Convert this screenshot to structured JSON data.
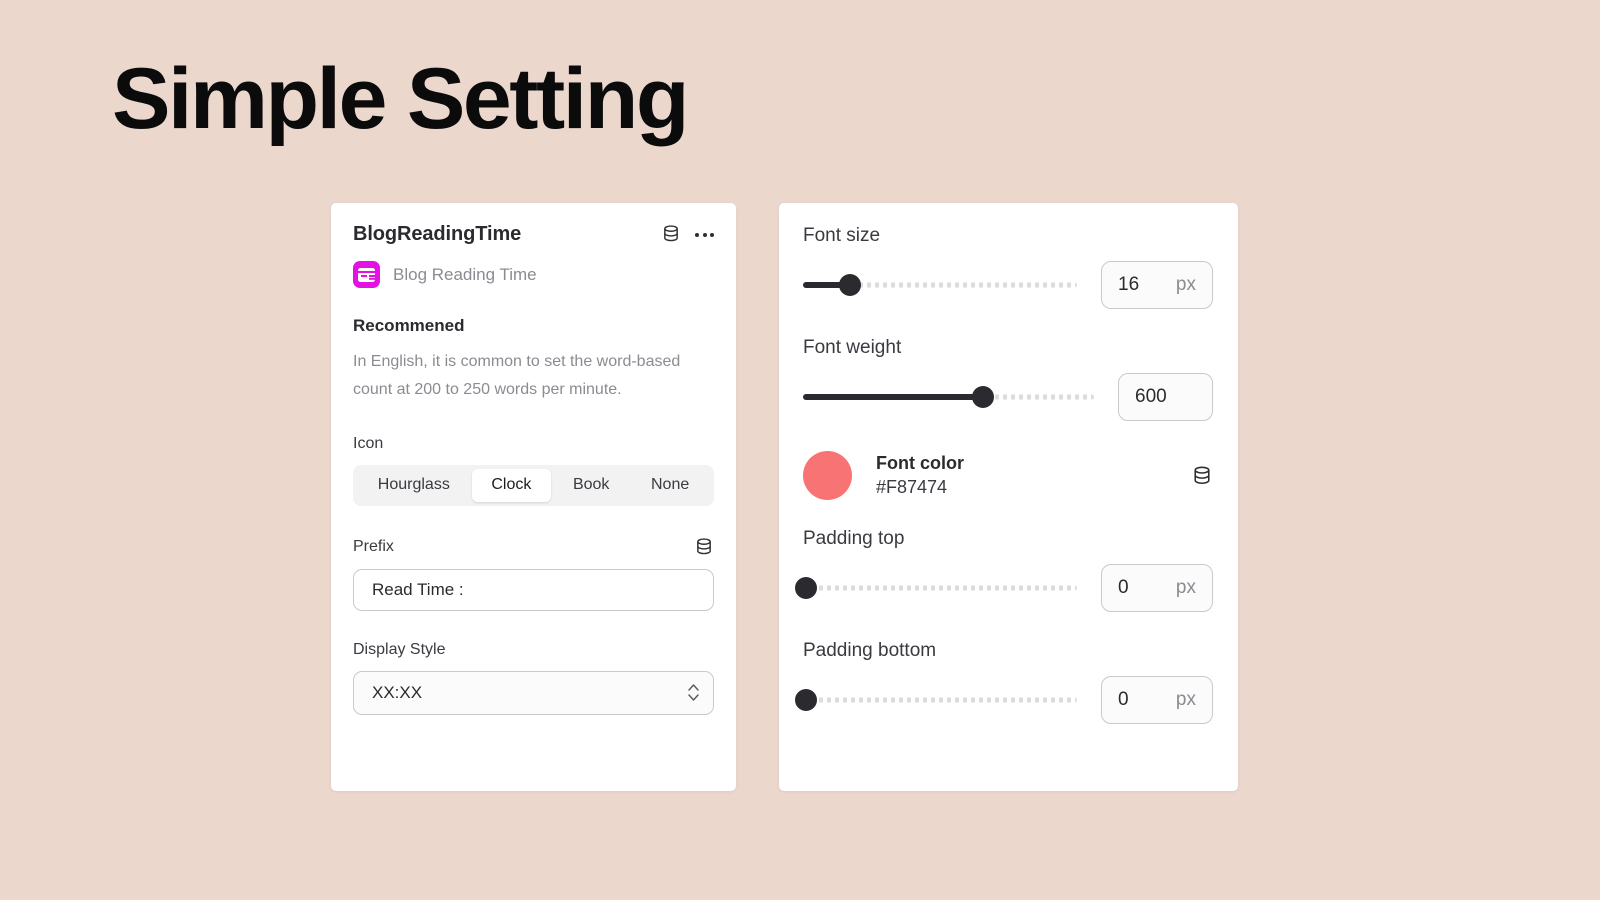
{
  "page": {
    "title": "Simple Setting",
    "background_color": "#EBD7CC"
  },
  "left_panel": {
    "title": "BlogReadingTime",
    "database_icon": "database-icon",
    "more_icon": "more-options-icon",
    "app_icon": "blog-reading-time-app-icon",
    "app_icon_color": "#E312E3",
    "app_name": "Blog Reading Time",
    "recommend": {
      "heading": "Recommened",
      "body": "In English, it is common to set the word-based count at 200 to 250 words per minute."
    },
    "icon_field": {
      "label": "Icon",
      "options": [
        "Hourglass",
        "Clock",
        "Book",
        "None"
      ],
      "selected": "Clock"
    },
    "prefix_field": {
      "label": "Prefix",
      "database_icon": "database-icon",
      "value": "Read Time :",
      "placeholder": "Read Time :"
    },
    "display_style_field": {
      "label": "Display Style",
      "value": "XX:XX",
      "options": [
        "XX:XX"
      ]
    }
  },
  "right_panel": {
    "font_size": {
      "label": "Font size",
      "value": "16",
      "unit": "px",
      "percent": 17,
      "min": 0,
      "max": 100
    },
    "font_weight": {
      "label": "Font weight",
      "value": "600",
      "unit": "",
      "percent": 62,
      "min": 100,
      "max": 900
    },
    "font_color": {
      "label": "Font color",
      "value": "#F87474",
      "swatch_color": "#F87474",
      "database_icon": "database-icon"
    },
    "padding_top": {
      "label": "Padding top",
      "value": "0",
      "unit": "px",
      "percent": 0,
      "min": 0,
      "max": 100
    },
    "padding_bottom": {
      "label": "Padding bottom",
      "value": "0",
      "unit": "px",
      "percent": 0,
      "min": 0,
      "max": 100
    }
  }
}
